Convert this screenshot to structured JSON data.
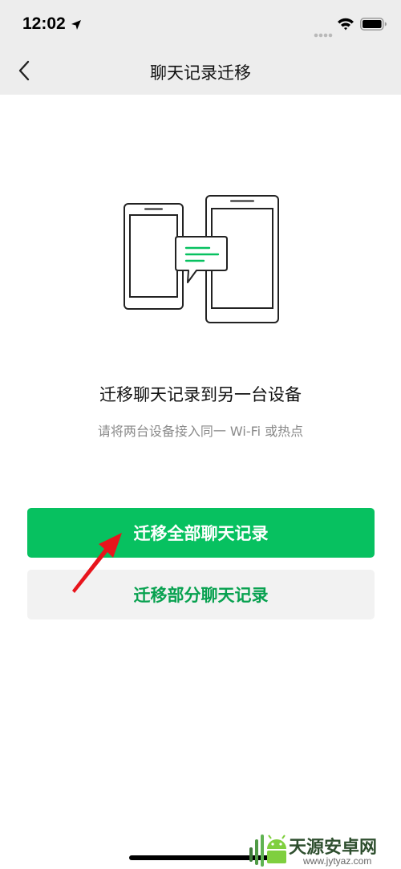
{
  "status_bar": {
    "time": "12:02"
  },
  "nav": {
    "title": "聊天记录迁移"
  },
  "content": {
    "headline": "迁移聊天记录到另一台设备",
    "subline": "请将两台设备接入同一 Wi-Fi 或热点"
  },
  "buttons": {
    "migrate_all": "迁移全部聊天记录",
    "migrate_partial": "迁移部分聊天记录"
  },
  "colors": {
    "accent": "#07c160",
    "accent_text": "#07a14f",
    "nav_bg": "#ededed",
    "arrow": "#e8141c"
  },
  "icons": [
    "back-chevron-icon",
    "location-arrow-icon",
    "cellular-signal-icon",
    "wifi-icon",
    "battery-icon",
    "two-phones-chat-illustration"
  ],
  "watermark": {
    "title": "天源安卓网",
    "url": "www.jytyaz.com"
  }
}
